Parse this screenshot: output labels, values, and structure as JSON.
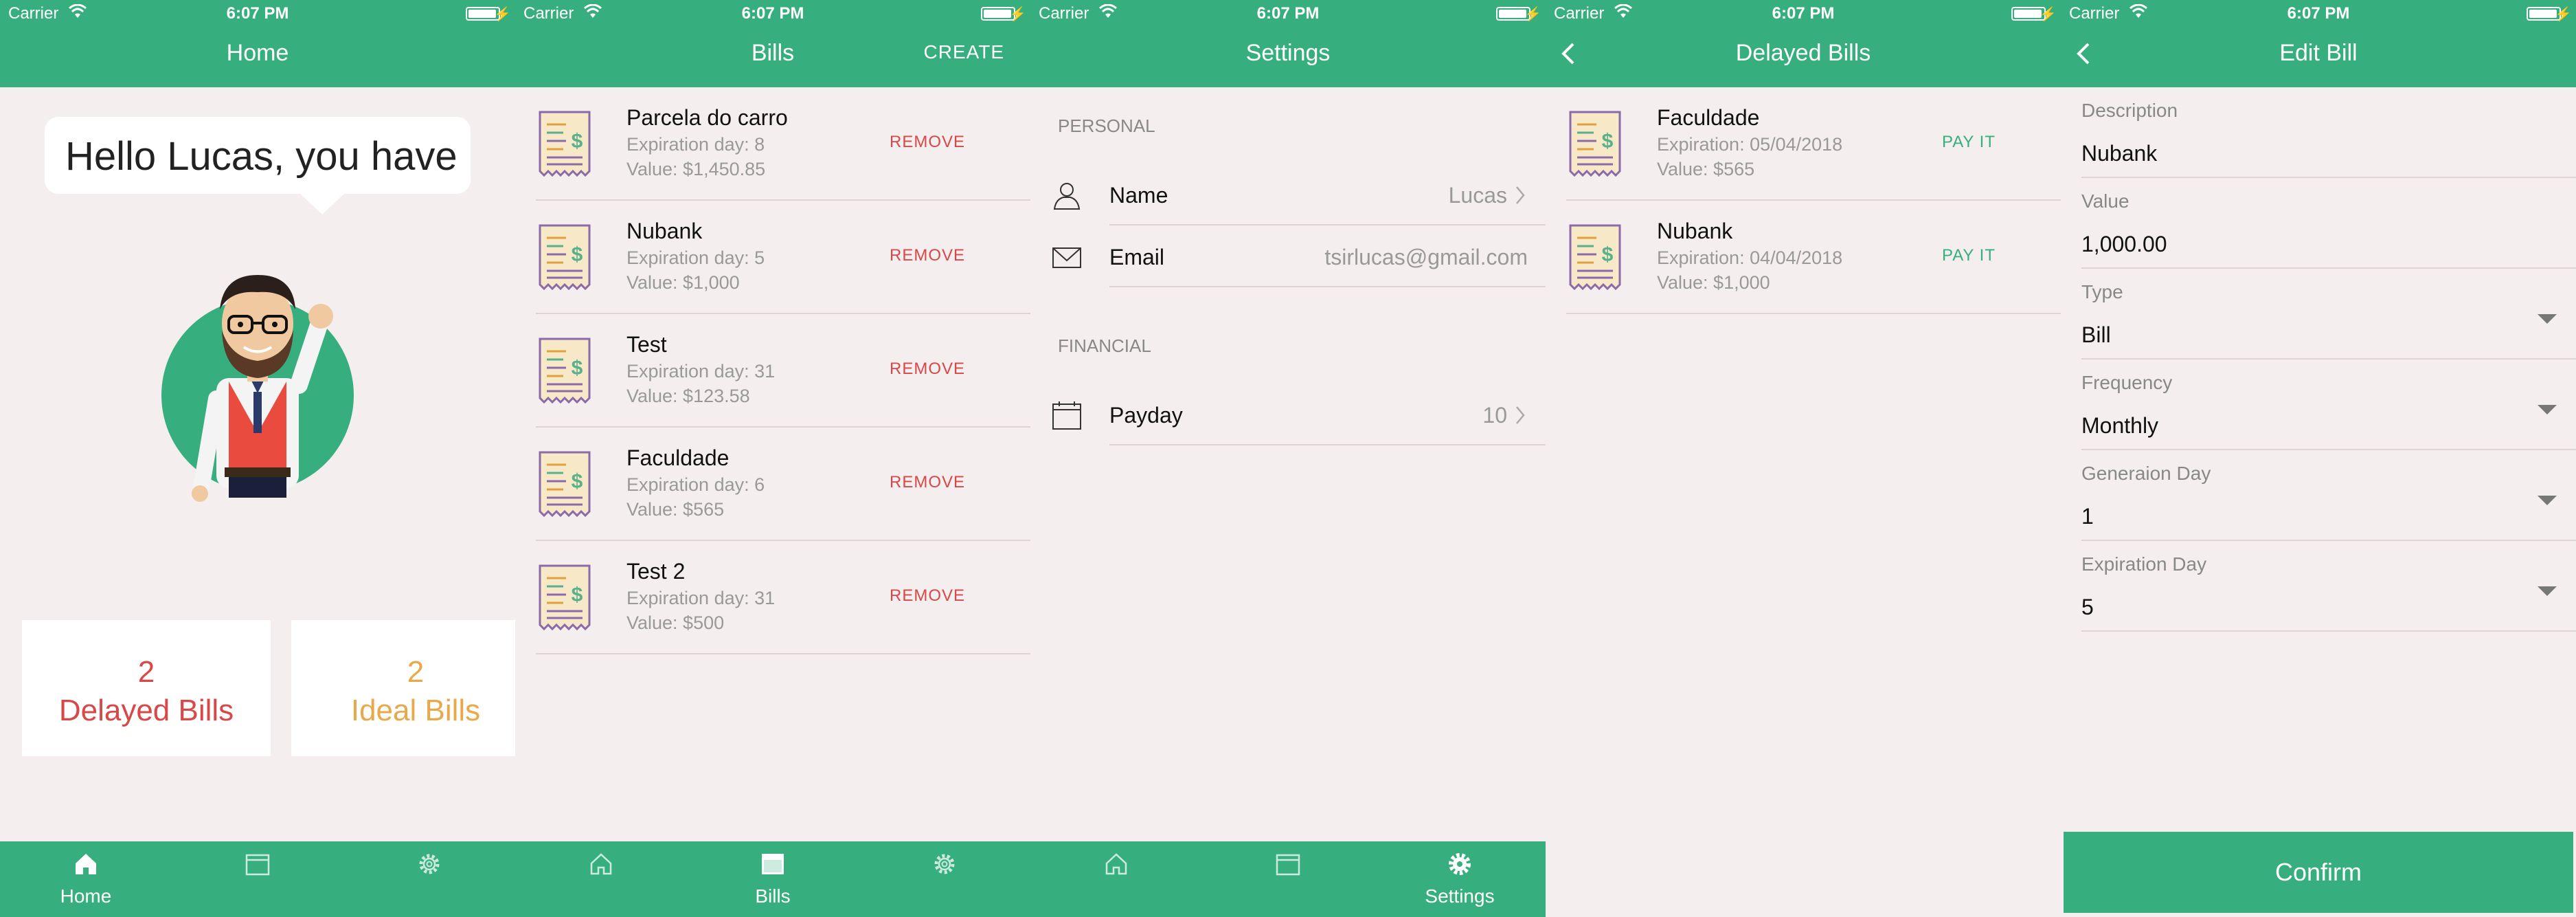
{
  "status": {
    "carrier": "Carrier",
    "time": "6:07 PM"
  },
  "colors": {
    "primary": "#37ae7e",
    "danger": "#d84848",
    "warning": "#e8a94a",
    "background": "#f4eeee"
  },
  "tabs": {
    "home": "Home",
    "bills": "Bills",
    "settings": "Settings"
  },
  "home": {
    "title": "Home",
    "greeting": "Hello Lucas, you have",
    "delayed": {
      "count": "2",
      "label": "Delayed Bills"
    },
    "ideal": {
      "count": "2",
      "label": "Ideal Bills"
    }
  },
  "bills": {
    "title": "Bills",
    "create_label": "CREATE",
    "remove_label": "REMOVE",
    "items": [
      {
        "name": "Parcela do carro",
        "expiration": "Expiration day: 8",
        "value": "Value: $1,450.85"
      },
      {
        "name": "Nubank",
        "expiration": "Expiration day: 5",
        "value": "Value: $1,000"
      },
      {
        "name": "Test",
        "expiration": "Expiration day: 31",
        "value": "Value: $123.58"
      },
      {
        "name": "Faculdade",
        "expiration": "Expiration day: 6",
        "value": "Value: $565"
      },
      {
        "name": "Test 2",
        "expiration": "Expiration day: 31",
        "value": "Value: $500"
      }
    ]
  },
  "settings": {
    "title": "Settings",
    "personal_header": "PERSONAL",
    "financial_header": "FINANCIAL",
    "name_label": "Name",
    "name_value": "Lucas",
    "email_label": "Email",
    "email_value": "tsirlucas@gmail.com",
    "payday_label": "Payday",
    "payday_value": "10"
  },
  "delayed": {
    "title": "Delayed Bills",
    "pay_label": "PAY IT",
    "items": [
      {
        "name": "Faculdade",
        "expiration": "Expiration: 05/04/2018",
        "value": "Value: $565"
      },
      {
        "name": "Nubank",
        "expiration": "Expiration: 04/04/2018",
        "value": "Value: $1,000"
      }
    ]
  },
  "edit": {
    "title": "Edit Bill",
    "fields": [
      {
        "label": "Description",
        "value": "Nubank"
      },
      {
        "label": "Value",
        "value": "1,000.00"
      },
      {
        "label": "Type",
        "value": "Bill"
      },
      {
        "label": "Frequency",
        "value": "Monthly"
      },
      {
        "label": "Generaion Day",
        "value": "1"
      },
      {
        "label": "Expiration Day",
        "value": "5"
      }
    ],
    "confirm_label": "Confirm"
  }
}
